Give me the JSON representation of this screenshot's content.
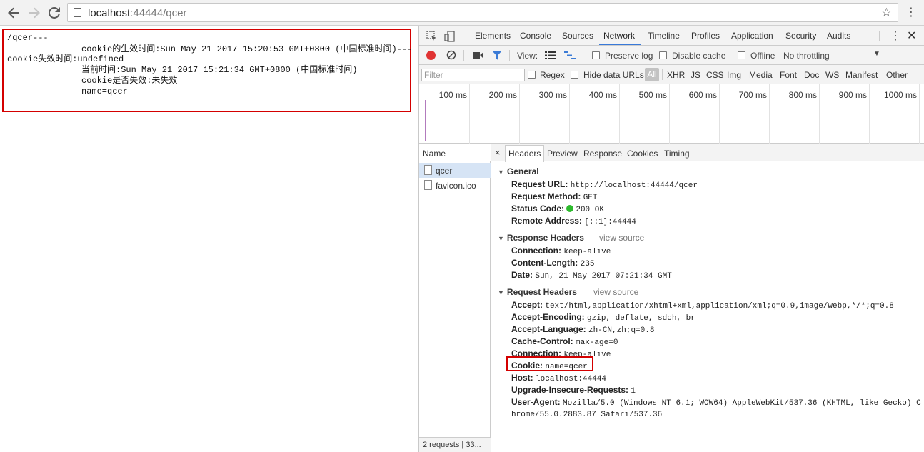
{
  "browser": {
    "url_host": "localhost",
    "url_path": ":44444/qcer"
  },
  "page": {
    "lines": [
      "/qcer---",
      "cookie的生效时间:Sun May 21 2017 15:20:53 GMT+0800 (中国标准时间)---",
      "cookie失效时间:undefined",
      "当前时间:Sun May 21 2017 15:21:34 GMT+0800 (中国标准时间)",
      "cookie是否失效:未失效",
      "name=qcer"
    ]
  },
  "devtools": {
    "tabs": [
      "Elements",
      "Console",
      "Sources",
      "Network",
      "Timeline",
      "Profiles",
      "Application",
      "Security",
      "Audits"
    ],
    "active_tab": "Network",
    "toolbar": {
      "view_label": "View:",
      "preserve_log": "Preserve log",
      "disable_cache": "Disable cache",
      "offline": "Offline",
      "throttling": "No throttling"
    },
    "filter": {
      "placeholder": "Filter",
      "regex": "Regex",
      "hide_data_urls": "Hide data URLs",
      "all": "All",
      "types": [
        "XHR",
        "JS",
        "CSS",
        "Img",
        "Media",
        "Font",
        "Doc",
        "WS",
        "Manifest",
        "Other"
      ]
    },
    "overview_ticks": [
      "100 ms",
      "200 ms",
      "300 ms",
      "400 ms",
      "500 ms",
      "600 ms",
      "700 ms",
      "800 ms",
      "900 ms",
      "1000 ms"
    ],
    "requests": {
      "header": "Name",
      "items": [
        "qcer",
        "favicon.ico"
      ],
      "footer": "2 requests | 33..."
    },
    "details": {
      "close": "×",
      "tabs": [
        "Headers",
        "Preview",
        "Response",
        "Cookies",
        "Timing"
      ],
      "general": {
        "title": "General",
        "rows": [
          {
            "k": "Request URL:",
            "v": "http://localhost:44444/qcer"
          },
          {
            "k": "Request Method:",
            "v": "GET"
          },
          {
            "k": "Status Code:",
            "v": "200 OK"
          },
          {
            "k": "Remote Address:",
            "v": "[::1]:44444"
          }
        ]
      },
      "response_headers": {
        "title": "Response Headers",
        "view_source": "view source",
        "rows": [
          {
            "k": "Connection:",
            "v": "keep-alive"
          },
          {
            "k": "Content-Length:",
            "v": "235"
          },
          {
            "k": "Date:",
            "v": "Sun, 21 May 2017 07:21:34 GMT"
          }
        ]
      },
      "request_headers": {
        "title": "Request Headers",
        "view_source": "view source",
        "rows": [
          {
            "k": "Accept:",
            "v": "text/html,application/xhtml+xml,application/xml;q=0.9,image/webp,*/*;q=0.8"
          },
          {
            "k": "Accept-Encoding:",
            "v": "gzip, deflate, sdch, br"
          },
          {
            "k": "Accept-Language:",
            "v": "zh-CN,zh;q=0.8"
          },
          {
            "k": "Cache-Control:",
            "v": "max-age=0"
          },
          {
            "k": "Connection:",
            "v": "keep-alive"
          },
          {
            "k": "Cookie:",
            "v": "name=qcer"
          },
          {
            "k": "Host:",
            "v": "localhost:44444"
          },
          {
            "k": "Upgrade-Insecure-Requests:",
            "v": "1"
          },
          {
            "k": "User-Agent:",
            "v": "Mozilla/5.0 (Windows NT 6.1; WOW64) AppleWebKit/537.36 (KHTML, like Gecko) C"
          }
        ],
        "ua_continuation": "hrome/55.0.2883.87 Safari/537.36"
      }
    }
  },
  "colors": {
    "highlight_red": "#d40000",
    "status_green": "#2dba2d",
    "active_blue": "#3879d9",
    "record_red": "#e03333"
  }
}
